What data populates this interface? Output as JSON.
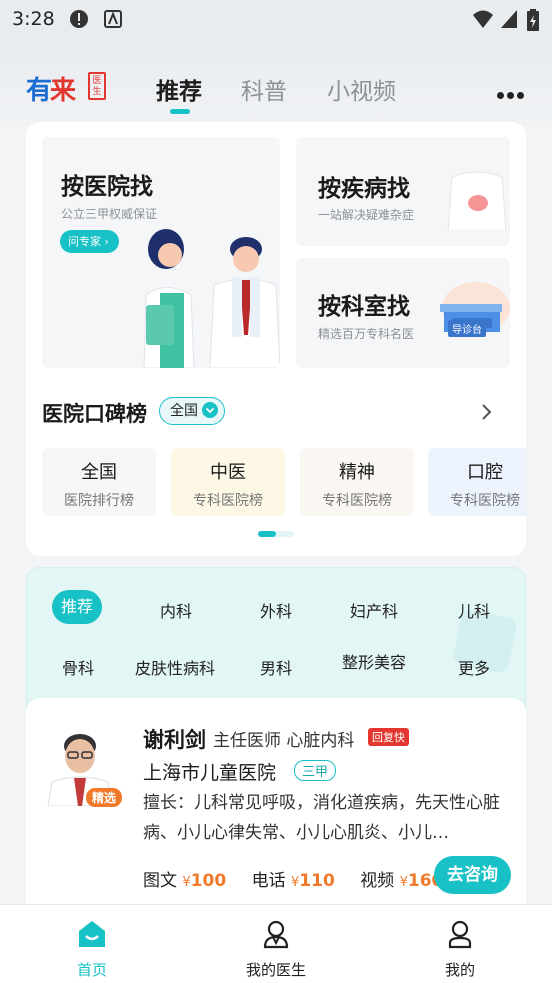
{
  "status_bar": {
    "time": "3:28"
  },
  "header": {
    "logo_text_a": "有",
    "logo_text_b": "来",
    "logo_tag": "医生",
    "tabs": [
      {
        "label": "推荐",
        "active": true
      },
      {
        "label": "科普",
        "active": false
      },
      {
        "label": "小视频",
        "active": false
      }
    ],
    "more_icon": "more-dots-icon"
  },
  "find": {
    "hospital": {
      "title": "按医院找",
      "subtitle": "公立三甲权威保证",
      "button": "问专家"
    },
    "disease": {
      "title": "按疾病找",
      "subtitle": "一站解决疑难杂症"
    },
    "department": {
      "title": "按科室找",
      "subtitle": "精选百万专科名医",
      "tag": "导诊台"
    }
  },
  "ranking": {
    "title": "医院口碑榜",
    "scope": "全国",
    "items": [
      {
        "name": "全国",
        "desc": "医院排行榜",
        "color": "#f5f6f8"
      },
      {
        "name": "中医",
        "desc": "专科医院榜",
        "color": "#fdf7e6"
      },
      {
        "name": "精神",
        "desc": "专科医院榜",
        "color": "#faf7f2"
      },
      {
        "name": "口腔",
        "desc": "专科医院榜",
        "color": "#ecf3fd"
      }
    ]
  },
  "departments": {
    "row1": [
      "推荐",
      "内科",
      "外科",
      "妇产科",
      "儿科"
    ],
    "row2": [
      "骨科",
      "皮肤性病科",
      "男科",
      "整形美容",
      "更多"
    ],
    "active": "推荐"
  },
  "doctor": {
    "badge": "精选",
    "name": "谢利剑",
    "title": "主任医师 心脏内科",
    "fast": "回复快",
    "hospital": "上海市儿童医院",
    "level": "三甲",
    "skill": "擅长：儿科常见呼吸，消化道疾病，先天性心脏病、小儿心律失常、小儿心肌炎、小儿…",
    "prices": [
      {
        "type": "图文",
        "price": "100"
      },
      {
        "type": "电话",
        "price": "110"
      },
      {
        "type": "视频",
        "price": "160"
      }
    ],
    "currency": "¥",
    "consult_button": "去咨询"
  },
  "bottom_nav": [
    {
      "label": "首页",
      "icon": "home-icon",
      "active": true
    },
    {
      "label": "我的医生",
      "icon": "doctor-icon",
      "active": false
    },
    {
      "label": "我的",
      "icon": "user-icon",
      "active": false
    }
  ],
  "colors": {
    "accent": "#18c1c6",
    "brand_blue": "#1b6dd1",
    "brand_red": "#e2362e",
    "price": "#f07a2a"
  }
}
